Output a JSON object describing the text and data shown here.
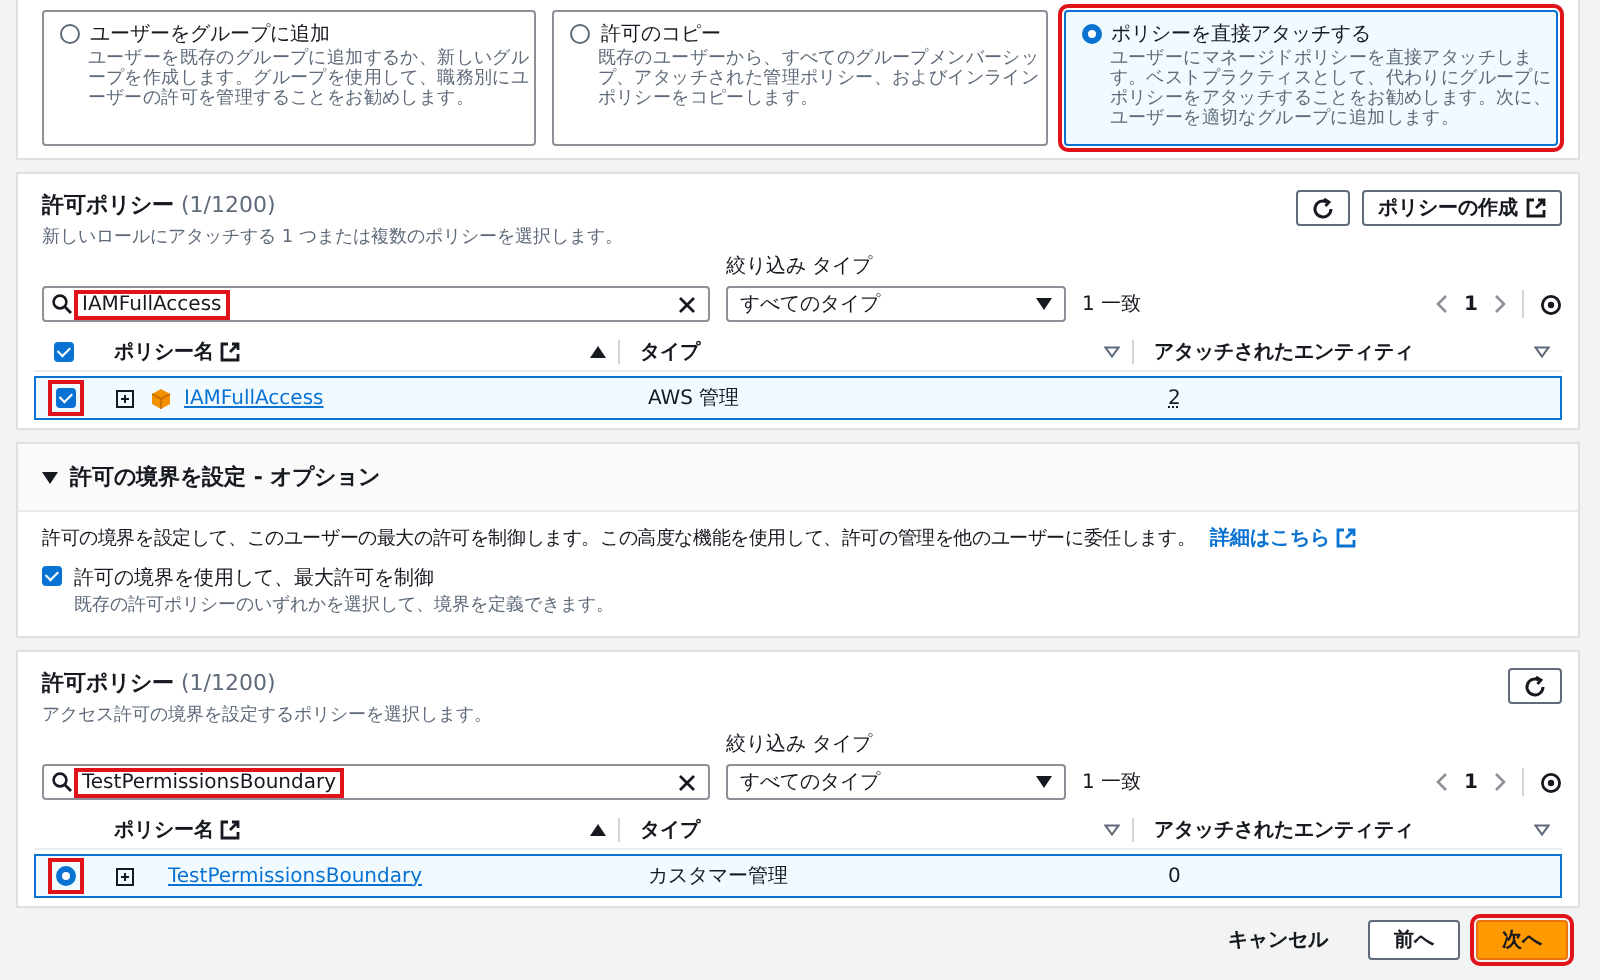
{
  "options": [
    {
      "title": "ユーザーをグループに追加",
      "description": "ユーザーを既存のグループに追加するか、新しいグループを作成します。グループを使用して、職務別にユーザーの許可を管理することをお勧めします。",
      "selected": false,
      "highlighted": false
    },
    {
      "title": "許可のコピー",
      "description": "既存のユーザーから、すべてのグループメンバーシップ、アタッチされた管理ポリシー、およびインラインポリシーをコピーします。",
      "selected": false,
      "highlighted": false
    },
    {
      "title": "ポリシーを直接アタッチする",
      "description": "ユーザーにマネージドポリシーを直接アタッチします。ベストプラクティスとして、代わりにグループにポリシーをアタッチすることをお勧めします。次に、ユーザーを適切なグループに追加します。",
      "selected": true,
      "highlighted": true
    }
  ],
  "permission_policies": {
    "title": "許可ポリシー",
    "count": "(1/1200)",
    "subtitle": "新しいロールにアタッチする 1 つまたは複数のポリシーを選択します。",
    "actions": [
      {
        "kind": "refresh"
      },
      {
        "kind": "create",
        "label": "ポリシーの作成"
      }
    ],
    "filter_label": "絞り込み タイプ",
    "search": {
      "value": "IAMFullAccess",
      "highlighted": true
    },
    "filter_value": "すべてのタイプ",
    "match_count": "1 一致",
    "page": "1",
    "multi_select": true,
    "header_checked": true,
    "columns": [
      {
        "label": "ポリシー名",
        "sorted": true,
        "external": true
      },
      {
        "label": "タイプ",
        "sorted": false,
        "external": false
      },
      {
        "label": "アタッチされたエンティティ",
        "sorted": false,
        "external": false
      }
    ],
    "rows": [
      {
        "kind": "aws",
        "name": "IAMFullAccess",
        "type": "AWS 管理",
        "entities": "2",
        "entities_linked": true,
        "selected": true,
        "highlighted": true
      }
    ]
  },
  "boundary": {
    "title": "許可の境界を設定 - オプション",
    "expanded": true,
    "description": "許可の境界を設定して、このユーザーの最大の許可を制御します。この高度な機能を使用して、許可の管理を他のユーザーに委任します。",
    "link": "詳細はこちら",
    "checkbox": {
      "label": "許可の境界を使用して、最大許可を制御",
      "hint": "既存の許可ポリシーのいずれかを選択して、境界を定義できます。",
      "checked": true
    }
  },
  "boundary_policies": {
    "title": "許可ポリシー",
    "count": "(1/1200)",
    "subtitle": "アクセス許可の境界を設定するポリシーを選択します。",
    "actions": [
      {
        "kind": "refresh"
      }
    ],
    "filter_label": "絞り込み タイプ",
    "search": {
      "value": "TestPermissionsBoundary",
      "highlighted": true
    },
    "filter_value": "すべてのタイプ",
    "match_count": "1 一致",
    "page": "1",
    "multi_select": false,
    "columns": [
      {
        "label": "ポリシー名",
        "sorted": true,
        "external": true
      },
      {
        "label": "タイプ",
        "sorted": false,
        "external": false
      },
      {
        "label": "アタッチされたエンティティ",
        "sorted": false,
        "external": false
      }
    ],
    "rows": [
      {
        "kind": "customer",
        "name": "TestPermissionsBoundary",
        "type": "カスタマー管理",
        "entities": "0",
        "entities_linked": false,
        "selected": true,
        "highlighted": true
      }
    ]
  },
  "footer": [
    {
      "kind": "link",
      "label": "キャンセル",
      "highlighted": false
    },
    {
      "kind": "normal",
      "label": "前へ",
      "highlighted": false
    },
    {
      "kind": "primary",
      "label": "次へ",
      "highlighted": true
    }
  ]
}
